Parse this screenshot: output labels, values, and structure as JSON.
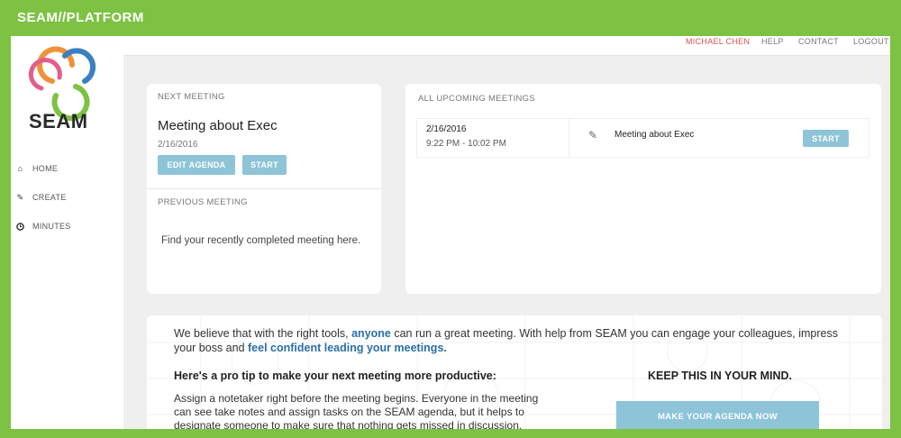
{
  "brand": {
    "title": "SEAM//PLATFORM"
  },
  "logo": {
    "text": "SEAM"
  },
  "sidebar": {
    "items": [
      {
        "label": "HOME",
        "icon": "home-icon"
      },
      {
        "label": "CREATE",
        "icon": "pencil-icon"
      },
      {
        "label": "MINUTES",
        "icon": "clock-icon"
      }
    ]
  },
  "topnav": {
    "user": "MICHAEL CHEN",
    "help": "HELP",
    "contact": "CONTACT",
    "logout": "LOGOUT"
  },
  "next_meeting": {
    "heading": "NEXT MEETING",
    "title": "Meeting about Exec",
    "date": "2/16/2016",
    "edit_label": "EDIT AGENDA",
    "start_label": "START"
  },
  "previous_meeting": {
    "heading": "PREVIOUS MEETING",
    "message": "Find your recently completed meeting here."
  },
  "upcoming": {
    "heading": "ALL UPCOMING MEETINGS",
    "rows": [
      {
        "date": "2/16/2016",
        "time": "9:22 PM - 10:02 PM",
        "title": "Meeting about Exec",
        "start_label": "START"
      }
    ]
  },
  "tip": {
    "intro_1": "We believe that with the right tools, ",
    "intro_link_1": "anyone",
    "intro_2": " can run a great meeting. With help from SEAM you can engage your colleagues, impress your boss and ",
    "intro_link_2": "feel confident leading your meetings.",
    "pro_tip_heading": "Here's a pro tip to make your next meeting more productive:",
    "keep_heading": "KEEP THIS IN YOUR MIND.",
    "body": "Assign a notetaker right before the meeting begins. Everyone in the meeting can see take notes and assign tasks on the SEAM agenda, but it helps to designate someone to make sure that nothing gets missed in discussion.",
    "cta_label": "MAKE YOUR AGENDA NOW"
  },
  "colors": {
    "brand_green": "#7dc242",
    "accent_blue": "#8dc4d8",
    "link_blue": "#2b6fa8",
    "user_red": "#d9534f"
  }
}
